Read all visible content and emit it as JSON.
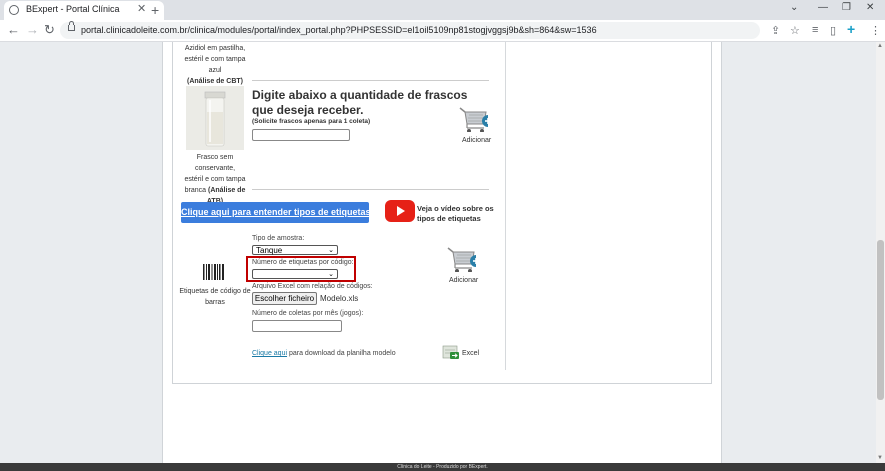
{
  "browser": {
    "tab_title": "BExpert - Portal Clínica",
    "url": "portal.clinicadoleite.com.br/clinica/modules/portal/index_portal.php?PHPSESSID=el1oil5109np81stogjvggsj9b&sh=864&sw=1536"
  },
  "section_top": {
    "line1": "Azidiol em pastilha,",
    "line2": "estéril e com tampa azul",
    "line3": "(Análise de CBT)"
  },
  "flask_section": {
    "heading_line1": "Digite abaixo a quantidade de frascos",
    "heading_line2": "que deseja receber.",
    "note": "(Solicite frascos apenas para 1 coleta)",
    "quantity_value": "",
    "caption_line1": "Frasco sem conservante,",
    "caption_line2": "estéril e com tampa",
    "caption_line3_normal": "branca ",
    "caption_line3_bold": "(Análise de ATB)",
    "add_label": "Adicionar"
  },
  "labels_section": {
    "info_button": "Clique aqui para entender tipos de etiquetas",
    "video_text_line1": "Veja o vídeo sobre os",
    "video_text_line2": "tipos de etiquetas",
    "barcode_caption_line1": "Etiquetas de código de",
    "barcode_caption_line2": "barras",
    "sample_type_label": "Tipo de amostra:",
    "sample_type_value": "Tanque",
    "labels_per_code_label": "Número de etiquetas por código:",
    "labels_per_code_value": "",
    "excel_file_label": "Arquivo Excel com relação de códigos:",
    "choose_file_button": "Escolher ficheiro",
    "file_name": "Modelo.xls",
    "collections_label": "Número de coletas por mês (jogos):",
    "collections_value": "",
    "download_link": "Clique aqui",
    "download_text": " para download da planilha modelo",
    "excel_label": "Excel",
    "add_label": "Adicionar"
  },
  "footer": {
    "text": "Clínica do Leite - Produzido por BExpert."
  },
  "colors": {
    "info_button": "#3b7ddd",
    "highlight_border": "#c00000",
    "youtube_red": "#e62117"
  }
}
